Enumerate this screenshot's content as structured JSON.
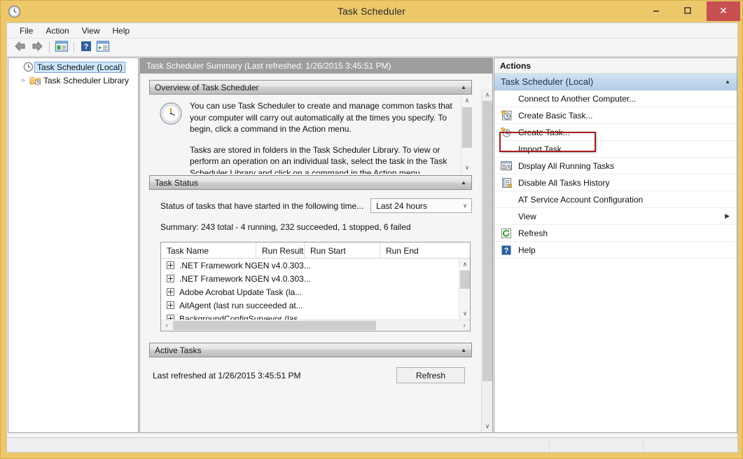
{
  "window": {
    "title": "Task Scheduler",
    "app_icon": "clock-icon",
    "minimize_label": "–",
    "maximize_label": "☐",
    "close_label": "✕"
  },
  "menubar": {
    "items": [
      {
        "label": "File"
      },
      {
        "label": "Action"
      },
      {
        "label": "View"
      },
      {
        "label": "Help"
      }
    ]
  },
  "toolbar": {
    "buttons": [
      {
        "name": "back-arrow-icon"
      },
      {
        "name": "forward-arrow-icon"
      },
      {
        "name": "show-hide-tree-icon"
      },
      {
        "name": "help-icon"
      },
      {
        "name": "properties-icon"
      }
    ]
  },
  "tree": {
    "items": [
      {
        "label": "Task Scheduler (Local)",
        "icon": "clock-icon",
        "selected": true,
        "expander": ""
      },
      {
        "label": "Task Scheduler Library",
        "icon": "folder-clock-icon",
        "selected": false,
        "expander": "▹"
      }
    ]
  },
  "main": {
    "header": "Task Scheduler Summary (Last refreshed: 1/26/2015 3:45:51 PM)",
    "overview": {
      "title": "Overview of Task Scheduler",
      "collapse_glyph": "▲",
      "icon": "clock-large-icon",
      "paragraph1": "You can use Task Scheduler to create and manage common tasks that your computer will carry out automatically at the times you specify. To begin, click a command in the Action menu.",
      "paragraph2": "Tasks are stored in folders in the Task Scheduler Library. To view or perform an operation on an individual task, select the task in the Task Scheduler Library and click on a command in the Action menu."
    },
    "task_status": {
      "title": "Task Status",
      "collapse_glyph": "▲",
      "status_label": "Status of tasks that have started in the following time...",
      "period_value": "Last 24 hours",
      "period_chevron": "∨",
      "summary": "Summary: 243 total - 4 running, 232 succeeded, 1 stopped, 6 failed",
      "columns": [
        {
          "label": "Task Name",
          "width": 136
        },
        {
          "label": "Run Result",
          "width": 69
        },
        {
          "label": "Run Start",
          "width": 108
        },
        {
          "label": "Run End",
          "width": 100
        }
      ],
      "rows": [
        {
          "task_name": ".NET Framework NGEN v4.0.303...",
          "run_result": "",
          "run_start": "",
          "run_end": ""
        },
        {
          "task_name": ".NET Framework NGEN v4.0.303...",
          "run_result": "",
          "run_start": "",
          "run_end": ""
        },
        {
          "task_name": "Adobe Acrobat Update Task (la...",
          "run_result": "",
          "run_start": "",
          "run_end": ""
        },
        {
          "task_name": "AitAgent (last run succeeded at...",
          "run_result": "",
          "run_start": "",
          "run_end": ""
        },
        {
          "task_name": "BackgroundConfigSurveyor (las",
          "run_result": "",
          "run_start": "",
          "run_end": ""
        }
      ],
      "scroll_up_glyph": "∧",
      "scroll_down_glyph": "∨",
      "scroll_left_glyph": "‹",
      "scroll_right_glyph": "›"
    },
    "active_tasks": {
      "title": "Active Tasks",
      "collapse_glyph": "▲"
    },
    "footer": {
      "last_refreshed": "Last refreshed at 1/26/2015 3:45:51 PM",
      "refresh_label": "Refresh"
    },
    "scroll_up_glyph": "∧",
    "scroll_down_glyph": "∨"
  },
  "actions": {
    "title": "Actions",
    "group_title": "Task Scheduler (Local)",
    "group_collapse_glyph": "▲",
    "items": [
      {
        "label": "Connect to Another Computer...",
        "icon": ""
      },
      {
        "label": "Create Basic Task...",
        "icon": "create-basic-task-icon",
        "highlighted": true
      },
      {
        "label": "Create Task...",
        "icon": "create-task-icon"
      },
      {
        "label": "Import Task...",
        "icon": ""
      },
      {
        "label": "Display All Running Tasks",
        "icon": "display-running-tasks-icon"
      },
      {
        "label": "Disable All Tasks History",
        "icon": "disable-history-icon"
      },
      {
        "label": "AT Service Account Configuration",
        "icon": ""
      },
      {
        "label": "View",
        "icon": "",
        "submenu_glyph": "▶"
      },
      {
        "label": "Refresh",
        "icon": "refresh-icon"
      },
      {
        "label": "Help",
        "icon": "help-icon"
      }
    ]
  },
  "colors": {
    "frame": "#edc86b",
    "close_button": "#c75050",
    "header_gray": "#9d9d9d",
    "actions_header_blue": "#c2d7ec",
    "highlight_red": "#a61b1b",
    "selection_blue": "#cce8ff"
  }
}
